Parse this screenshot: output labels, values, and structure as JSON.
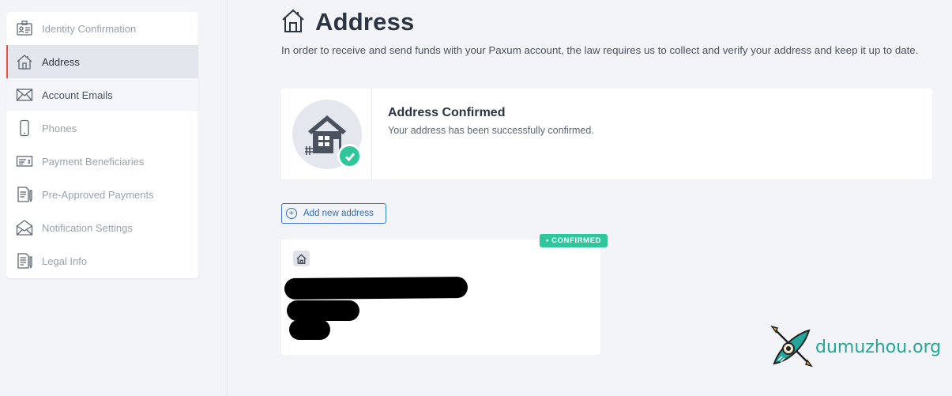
{
  "sidebar": {
    "items": [
      {
        "label": "Identity Confirmation",
        "icon": "id-card-icon"
      },
      {
        "label": "Address",
        "icon": "house-icon",
        "active": true
      },
      {
        "label": "Account Emails",
        "icon": "envelope-icon"
      },
      {
        "label": "Phones",
        "icon": "phone-icon"
      },
      {
        "label": "Payment Beneficiaries",
        "icon": "check-document-icon"
      },
      {
        "label": "Pre-Approved Payments",
        "icon": "document-pen-icon"
      },
      {
        "label": "Notification Settings",
        "icon": "open-envelope-icon"
      },
      {
        "label": "Legal Info",
        "icon": "legal-document-icon"
      }
    ]
  },
  "header": {
    "title": "Address",
    "intro": "In order to receive and send funds with your Paxum account, the law requires us to collect and verify your address and keep it up to date."
  },
  "status_card": {
    "title": "Address Confirmed",
    "subtitle": "Your address has been successfully confirmed."
  },
  "add_button": {
    "label": "Add new address"
  },
  "address_card": {
    "badge": "• CONFIRMED"
  },
  "watermark": {
    "text": "dumuzhou.org"
  },
  "colors": {
    "accent_blue": "#2e6bbd",
    "confirmed_green": "#2ec69a",
    "active_marker": "#e2564c",
    "watermark_teal": "#23a79a"
  }
}
